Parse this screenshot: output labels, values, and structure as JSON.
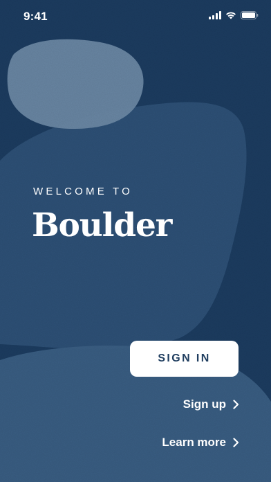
{
  "status_bar": {
    "time": "9:41",
    "icons": [
      "cellular-signal-icon",
      "wifi-icon",
      "battery-icon"
    ]
  },
  "welcome": {
    "label": "WELCOME TO",
    "title": "Boulder"
  },
  "actions": {
    "sign_in_label": "SIGN IN",
    "sign_up_label": "Sign up",
    "learn_more_label": "Learn more"
  },
  "colors": {
    "background": "#1d3d61",
    "stone_light": "#6f8ba6",
    "stone_mid": "#34577b",
    "button_text": "#1f3d5f",
    "button_bg": "#ffffff"
  }
}
